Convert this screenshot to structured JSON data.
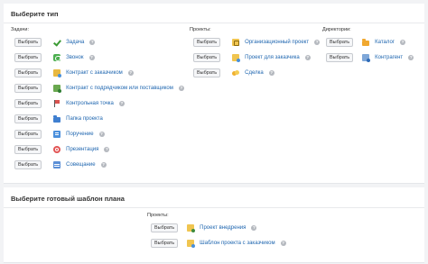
{
  "type_panel": {
    "title": "Выберите тип",
    "tasks": {
      "header": "Задачи:",
      "items": [
        {
          "button": "Выбрать",
          "label": "Задача",
          "icon": "checkmark-icon",
          "help": "?"
        },
        {
          "button": "Выбрать",
          "label": "Звонок",
          "icon": "phone-icon",
          "help": "?"
        },
        {
          "button": "Выбрать",
          "label": "Контракт с заказчиком",
          "icon": "contract-icon",
          "help": "?"
        },
        {
          "button": "Выбрать",
          "label": "Контракт с подрядчиком или поставщиком",
          "icon": "supplier-contract-icon",
          "help": "?"
        },
        {
          "button": "Выбрать",
          "label": "Контрольная точка",
          "icon": "flag-icon",
          "help": "?"
        },
        {
          "button": "Выбрать",
          "label": "Папка проекта",
          "icon": "folder-icon",
          "help": ""
        },
        {
          "button": "Выбрать",
          "label": "Поручение",
          "icon": "order-icon",
          "help": "?"
        },
        {
          "button": "Выбрать",
          "label": "Презентация",
          "icon": "presentation-icon",
          "help": "?"
        },
        {
          "button": "Выбрать",
          "label": "Совещание",
          "icon": "meeting-icon",
          "help": "?"
        }
      ]
    },
    "projects": {
      "header": "Проекты:",
      "items": [
        {
          "button": "Выбрать",
          "label": "Организационный проект",
          "icon": "org-project-icon",
          "help": "?"
        },
        {
          "button": "Выбрать",
          "label": "Проект для заказчика",
          "icon": "client-project-icon",
          "help": "?"
        },
        {
          "button": "Выбрать",
          "label": "Сделка",
          "icon": "deal-icon",
          "help": "?"
        }
      ]
    },
    "directories": {
      "header": "Директории:",
      "items": [
        {
          "button": "Выбрать",
          "label": "Каталог",
          "icon": "catalog-folder-icon",
          "help": "?"
        },
        {
          "button": "Выбрать",
          "label": "Контрагент",
          "icon": "contractor-icon",
          "help": "?"
        }
      ]
    }
  },
  "template_panel": {
    "title": "Выберите готовый шаблон плана",
    "projects": {
      "header": "Проекты:",
      "items": [
        {
          "button": "Выбрать",
          "label": "Проект внедрения",
          "icon": "implementation-project-icon",
          "help": "?"
        },
        {
          "button": "Выбрать",
          "label": "Шаблон проекта с заказчиком",
          "icon": "client-template-icon",
          "help": "?"
        }
      ]
    }
  }
}
